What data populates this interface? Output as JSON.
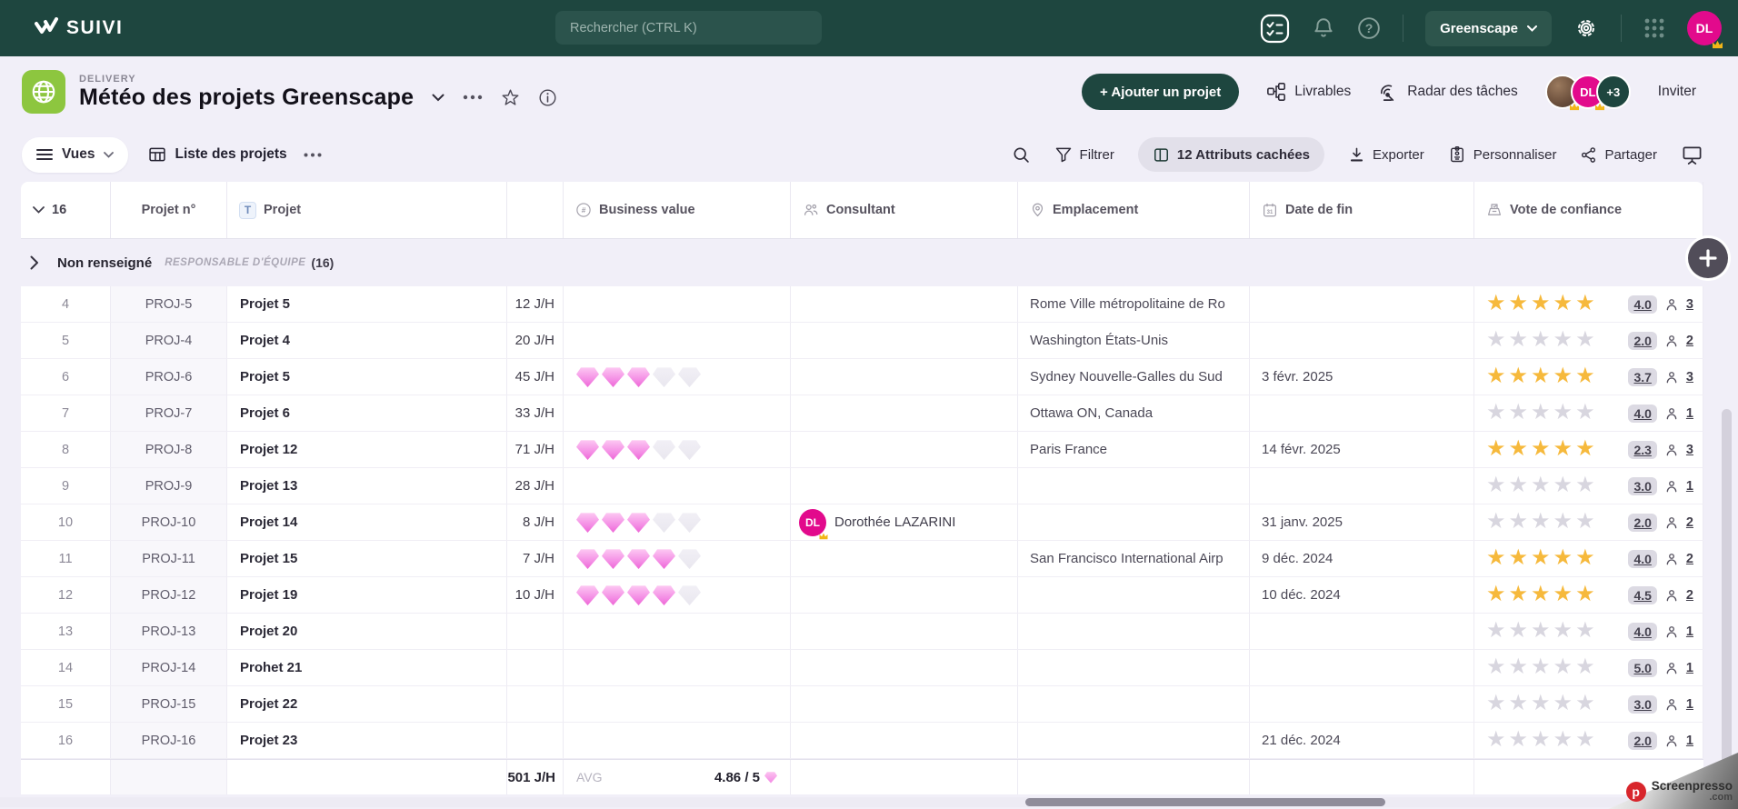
{
  "topbar": {
    "logo": "SUIVI",
    "search_placeholder": "Rechercher (CTRL K)",
    "workspace": "Greenscape",
    "avatar_initials": "DL"
  },
  "header": {
    "category": "DELIVERY",
    "title": "Météo des projets Greenscape",
    "add_button": "+ Ajouter un projet",
    "livrables": "Livrables",
    "radar": "Radar des tâches",
    "avatar_initials": "DL",
    "more_count": "+3",
    "invite": "Inviter"
  },
  "toolbar": {
    "views": "Vues",
    "view_tab": "Liste des projets",
    "filter": "Filtrer",
    "hidden_attributes": "12 Attributs cachées",
    "export": "Exporter",
    "customize": "Personnaliser",
    "share": "Partager"
  },
  "table": {
    "visible_count": "16",
    "columns": {
      "project_no": "Projet n°",
      "project": "Projet",
      "business_value": "Business value",
      "consultant": "Consultant",
      "location": "Emplacement",
      "end_date": "Date de fin",
      "confidence_vote": "Vote de confiance"
    },
    "group": {
      "name": "Non renseigné",
      "type": "RESPONSABLE D'ÉQUIPE",
      "count": "(16)"
    },
    "rows": [
      {
        "num": "4",
        "id": "PROJ-5",
        "name": "Projet 5",
        "effort": "12 J/H",
        "gems": 0,
        "consultant": "",
        "initials": "",
        "location": "Rome Ville métropolitaine de Ro",
        "due": "",
        "stars": "gold",
        "score": "4.0",
        "votes": "3"
      },
      {
        "num": "5",
        "id": "PROJ-4",
        "name": "Projet 4",
        "effort": "20 J/H",
        "gems": 0,
        "consultant": "",
        "initials": "",
        "location": "Washington États-Unis",
        "due": "",
        "stars": "gray",
        "score": "2.0",
        "votes": "2"
      },
      {
        "num": "6",
        "id": "PROJ-6",
        "name": "Projet 5",
        "effort": "45 J/H",
        "gems": 3,
        "consultant": "",
        "initials": "",
        "location": "Sydney Nouvelle-Galles du Sud",
        "due": "3 févr. 2025",
        "stars": "gold",
        "score": "3.7",
        "votes": "3"
      },
      {
        "num": "7",
        "id": "PROJ-7",
        "name": "Projet 6",
        "effort": "33 J/H",
        "gems": 0,
        "consultant": "",
        "initials": "",
        "location": "Ottawa ON, Canada",
        "due": "",
        "stars": "gray",
        "score": "4.0",
        "votes": "1"
      },
      {
        "num": "8",
        "id": "PROJ-8",
        "name": "Projet 12",
        "effort": "71 J/H",
        "gems": 3,
        "consultant": "",
        "initials": "",
        "location": "Paris France",
        "due": "14 févr. 2025",
        "stars": "gold",
        "score": "2.3",
        "votes": "3"
      },
      {
        "num": "9",
        "id": "PROJ-9",
        "name": "Projet 13",
        "effort": "28 J/H",
        "gems": 0,
        "consultant": "",
        "initials": "",
        "location": "",
        "due": "",
        "stars": "gray",
        "score": "3.0",
        "votes": "1"
      },
      {
        "num": "10",
        "id": "PROJ-10",
        "name": "Projet 14",
        "effort": "8 J/H",
        "gems": 3,
        "consultant": "Dorothée LAZARINI",
        "initials": "DL",
        "location": "",
        "due": "31 janv. 2025",
        "stars": "gray",
        "score": "2.0",
        "votes": "2"
      },
      {
        "num": "11",
        "id": "PROJ-11",
        "name": "Projet 15",
        "effort": "7 J/H",
        "gems": 4,
        "consultant": "",
        "initials": "",
        "location": "San Francisco International Airp",
        "due": "9 déc. 2024",
        "stars": "gold",
        "score": "4.0",
        "votes": "2"
      },
      {
        "num": "12",
        "id": "PROJ-12",
        "name": "Projet 19",
        "effort": "10 J/H",
        "gems": 4,
        "consultant": "",
        "initials": "",
        "location": "",
        "due": "10 déc. 2024",
        "stars": "gold",
        "score": "4.5",
        "votes": "2"
      },
      {
        "num": "13",
        "id": "PROJ-13",
        "name": "Projet 20",
        "effort": "",
        "gems": 0,
        "consultant": "",
        "initials": "",
        "location": "",
        "due": "",
        "stars": "gray",
        "score": "4.0",
        "votes": "1"
      },
      {
        "num": "14",
        "id": "PROJ-14",
        "name": "Prohet 21",
        "effort": "",
        "gems": 0,
        "consultant": "",
        "initials": "",
        "location": "",
        "due": "",
        "stars": "gray",
        "score": "5.0",
        "votes": "1"
      },
      {
        "num": "15",
        "id": "PROJ-15",
        "name": "Projet 22",
        "effort": "",
        "gems": 0,
        "consultant": "",
        "initials": "",
        "location": "",
        "due": "",
        "stars": "gray",
        "score": "3.0",
        "votes": "1"
      },
      {
        "num": "16",
        "id": "PROJ-16",
        "name": "Projet 23",
        "effort": "",
        "gems": 0,
        "consultant": "",
        "initials": "",
        "location": "",
        "due": "21 déc. 2024",
        "stars": "gray",
        "score": "2.0",
        "votes": "1"
      }
    ],
    "footer": {
      "effort_total": "501 J/H",
      "avg_label": "AVG",
      "avg_value": "4.86 / 5"
    }
  },
  "watermark": {
    "brand": "Screenpresso",
    "tld": ".com"
  },
  "colors": {
    "topbar": "#1e463f",
    "accent_button": "#1e463f",
    "app_icon": "#8dc63f",
    "avatar": "#e20a8c",
    "star_gold": "#f6b93c",
    "star_gray": "#d8d6df",
    "gem_pink": "#f387e3",
    "page_bg": "#f1eff8"
  }
}
